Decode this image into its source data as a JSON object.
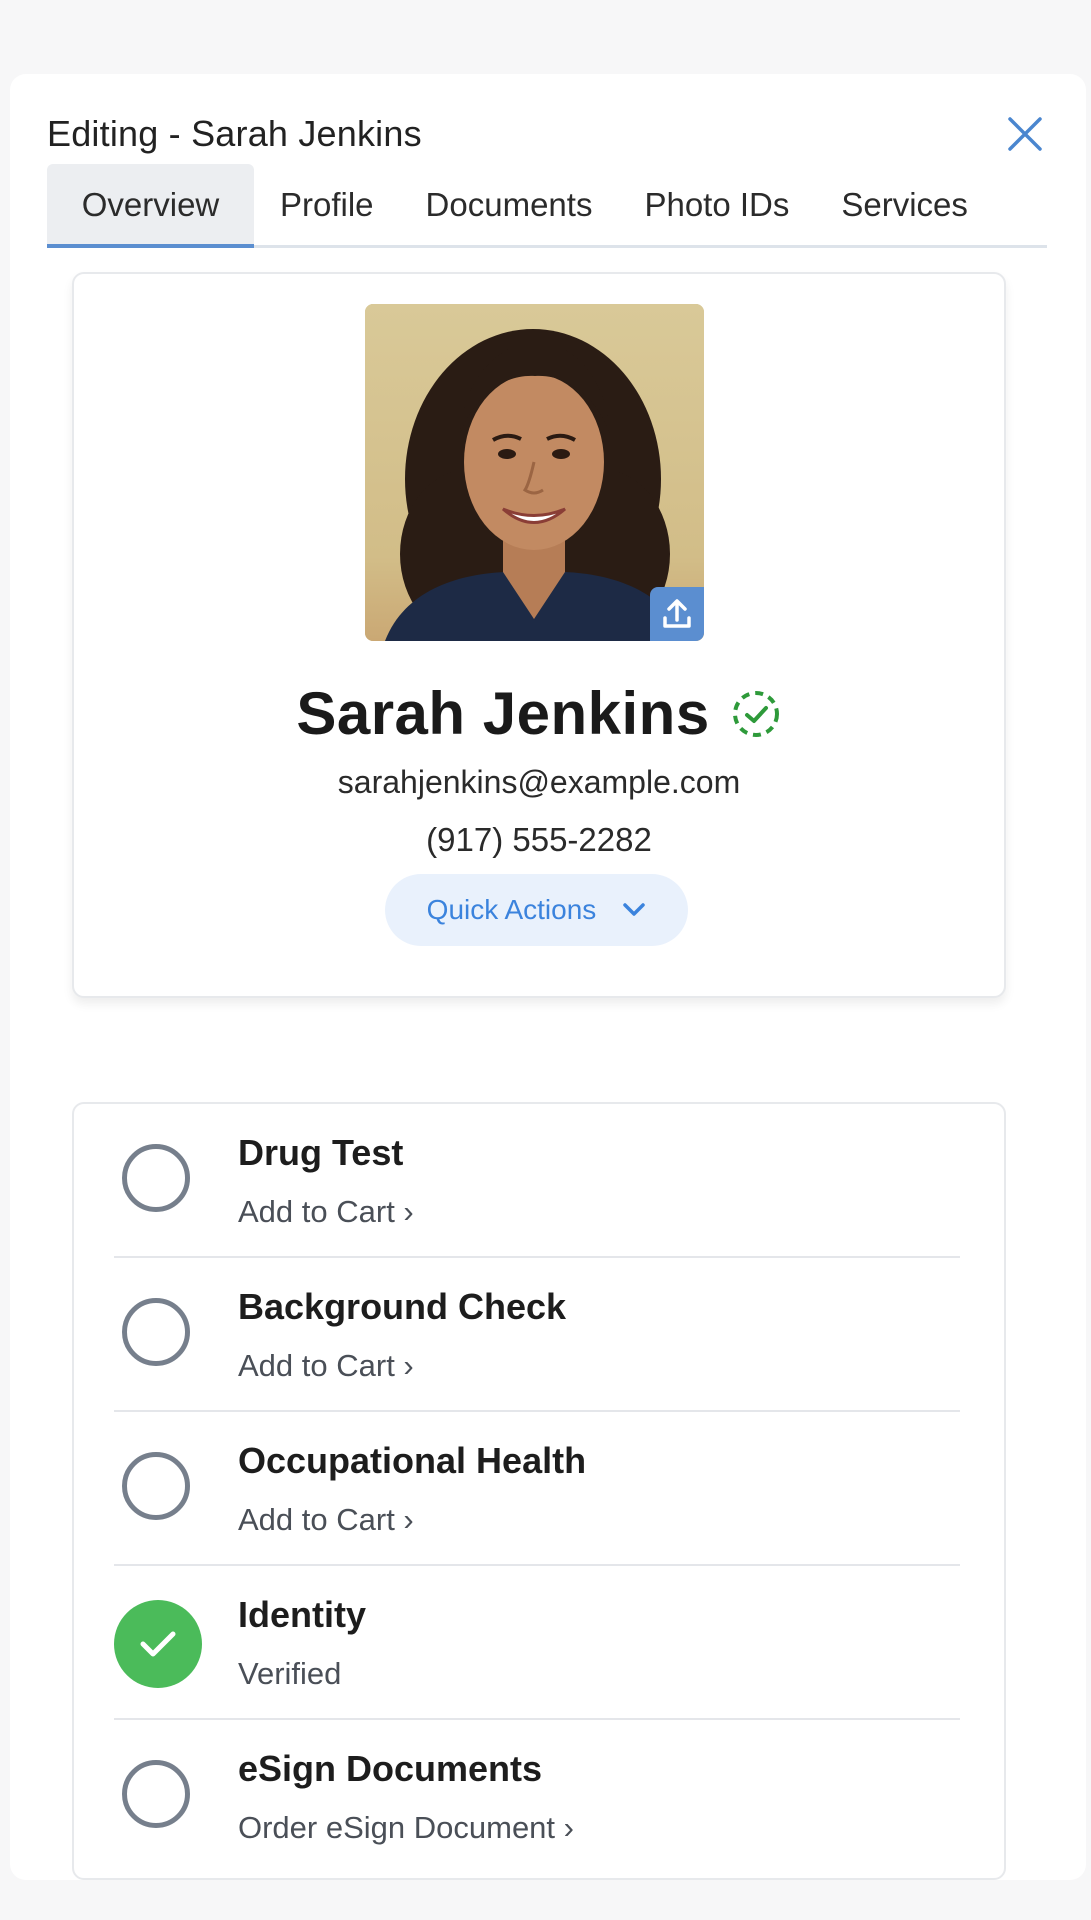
{
  "header": {
    "title": "Editing - Sarah Jenkins",
    "close_icon": "close-icon"
  },
  "tabs": [
    {
      "label": "Overview",
      "active": true
    },
    {
      "label": "Profile",
      "active": false
    },
    {
      "label": "Documents",
      "active": false
    },
    {
      "label": "Photo IDs",
      "active": false
    },
    {
      "label": "Services",
      "active": false
    }
  ],
  "profile": {
    "name": "Sarah Jenkins",
    "verified_icon": "verified-badge-icon",
    "email": "sarahjenkins@example.com",
    "phone": "(917) 555-2282",
    "upload_icon": "upload-icon",
    "quick_actions_label": "Quick Actions"
  },
  "services": [
    {
      "title": "Drug Test",
      "action": "Add to Cart ›",
      "status": "unchecked"
    },
    {
      "title": "Background Check",
      "action": "Add to Cart ›",
      "status": "unchecked"
    },
    {
      "title": "Occupational Health",
      "action": "Add to Cart ›",
      "status": "unchecked"
    },
    {
      "title": "Identity",
      "action": "Verified",
      "status": "checked"
    },
    {
      "title": "eSign Documents",
      "action": "Order eSign Document ›",
      "status": "unchecked"
    }
  ],
  "colors": {
    "accent": "#5b8ed0",
    "quick_actions_text": "#3b83dd",
    "quick_actions_bg": "#e9f1fc",
    "verified_green": "#4bbb5a",
    "badge_green": "#2e9a3a"
  }
}
